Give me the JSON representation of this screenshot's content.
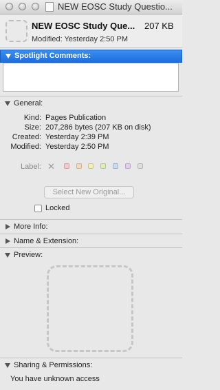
{
  "window": {
    "title": "NEW EOSC Study Questio...",
    "traffic_lights": [
      "close-button",
      "minimize-button",
      "zoom-button"
    ]
  },
  "header": {
    "file_name": "NEW EOSC Study Que...",
    "file_size": "207 KB",
    "modified": "Modified: Yesterday 2:50 PM"
  },
  "spotlight": {
    "label": "Spotlight Comments:",
    "value": ""
  },
  "general": {
    "label": "General:",
    "rows": [
      {
        "key": "Kind:",
        "value": "Pages Publication"
      },
      {
        "key": "Size:",
        "value": "207,286 bytes (207 KB on disk)"
      },
      {
        "key": "Created:",
        "value": "Yesterday 2:39 PM"
      },
      {
        "key": "Modified:",
        "value": "Yesterday 2:50 PM"
      }
    ],
    "label_title": "Label:",
    "label_clear": "✕",
    "label_colors": [
      "#f7c9c9",
      "#f6d9b8",
      "#f5efb3",
      "#dcefb8",
      "#c9daf5",
      "#e2cdf0",
      "#dedede"
    ],
    "select_original": "Select New Original...",
    "locked": "Locked",
    "locked_checked": false
  },
  "sections": {
    "more_info": "More Info:",
    "name_extension": "Name & Extension:",
    "preview": "Preview:",
    "sharing": "Sharing & Permissions:"
  },
  "sharing": {
    "access": "You have unknown access"
  }
}
